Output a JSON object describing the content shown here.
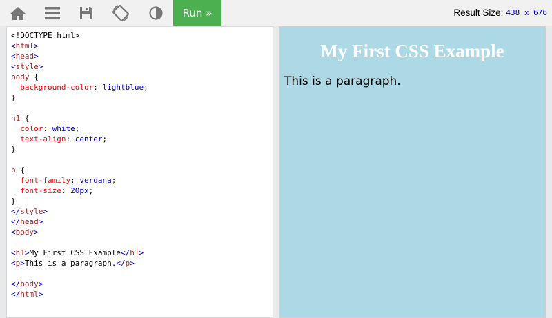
{
  "toolbar": {
    "icons": [
      "home-icon",
      "menu-icon",
      "save-icon",
      "rotate-icon",
      "contrast-icon"
    ],
    "run_label": "Run »",
    "result_size_label": "Result Size:",
    "result_size_value": "438 x 676"
  },
  "code_lines": [
    "<!DOCTYPE html>",
    "<html>",
    "<head>",
    "<style>",
    "body {",
    "  background-color: lightblue;",
    "}",
    "",
    "h1 {",
    "  color: white;",
    "  text-align: center;",
    "}",
    "",
    "p {",
    "  font-family: verdana;",
    "  font-size: 20px;",
    "}",
    "</style>",
    "</head>",
    "<body>",
    "",
    "<h1>My First CSS Example</h1>",
    "<p>This is a paragraph.</p>",
    "",
    "</body>",
    "</html>"
  ],
  "result": {
    "heading": "My First CSS Example",
    "paragraph": "This is a paragraph.",
    "background": "#add8e6"
  },
  "colors": {
    "run_button": "#4caf50",
    "toolbar": "#f1f1f1"
  }
}
